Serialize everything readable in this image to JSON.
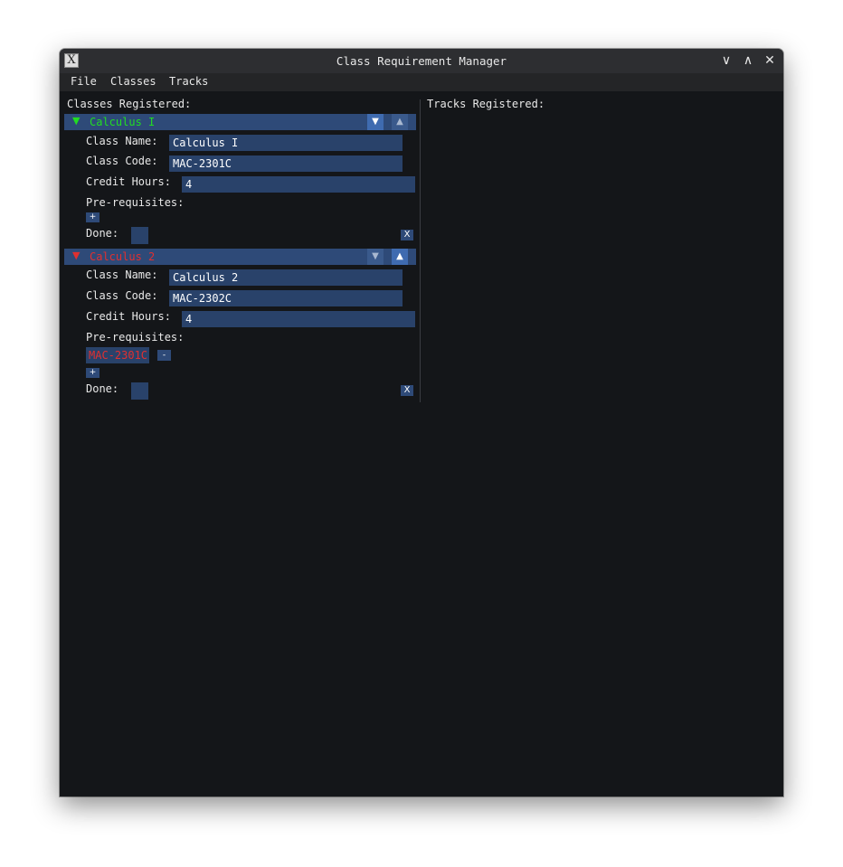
{
  "window": {
    "title": "Class Requirement Manager",
    "app_icon": "X",
    "controls": {
      "minimize": "∨",
      "maximize": "∧",
      "close": "✕"
    }
  },
  "menu": [
    "File",
    "Classes",
    "Tracks"
  ],
  "left_panel": {
    "heading": "Classes Registered:",
    "classes": [
      {
        "title": "Calculus I",
        "title_color": "#22dd22",
        "collapse_arrow": "▼",
        "move_down": "▼",
        "move_up": "▲",
        "name_label": "Class Name:",
        "name_value": "Calculus I",
        "code_label": "Class Code:",
        "code_value": "MAC-2301C",
        "credit_label": "Credit Hours:",
        "credit_value": "4",
        "prereq_label": "Pre-requisites:",
        "prerequisites": [],
        "add_prereq": "+",
        "done_label": "Done:",
        "delete_label": "X"
      },
      {
        "title": "Calculus 2",
        "title_color": "#e03030",
        "collapse_arrow": "▼",
        "move_down": "▼",
        "move_up": "▲",
        "name_label": "Class Name:",
        "name_value": "Calculus 2",
        "code_label": "Class Code:",
        "code_value": "MAC-2302C",
        "credit_label": "Credit Hours:",
        "credit_value": "4",
        "prereq_label": "Pre-requisites:",
        "prerequisites": [
          {
            "code": "MAC-2301C",
            "remove_label": "-"
          }
        ],
        "add_prereq": "+",
        "done_label": "Done:",
        "delete_label": "X"
      }
    ]
  },
  "right_panel": {
    "heading": "Tracks Registered:"
  },
  "colors": {
    "background": "#141619",
    "header": "#2e4a78",
    "field": "#29426a",
    "missing_prereq": "#e03030"
  }
}
